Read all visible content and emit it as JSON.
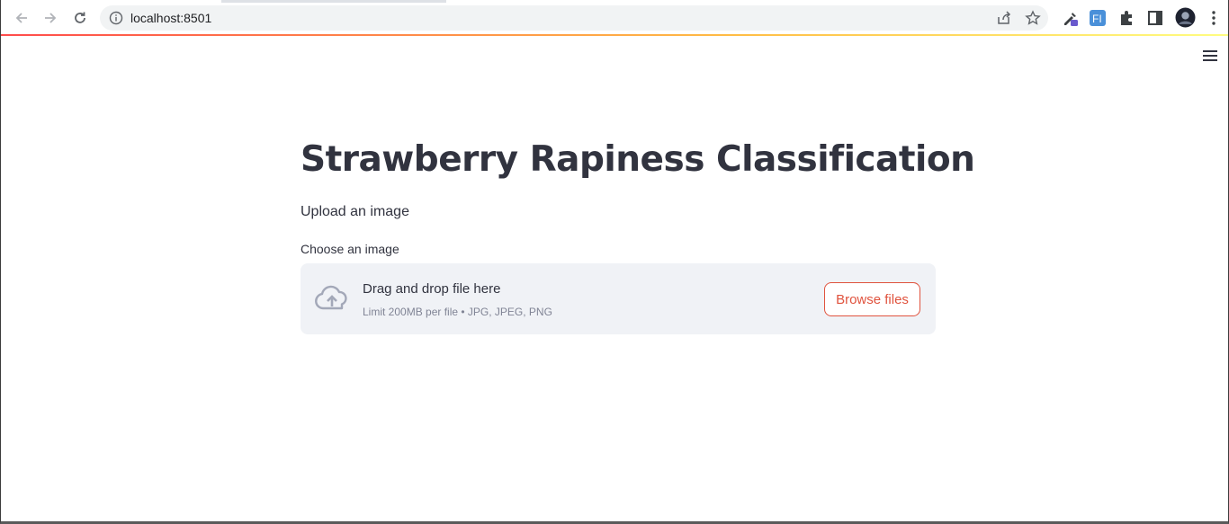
{
  "browser": {
    "url": "localhost:8501",
    "icons": [
      "back-arrow-icon",
      "forward-arrow-icon",
      "reload-icon",
      "info-icon",
      "share-icon",
      "star-icon",
      "eyedropper-extension-icon",
      "translate-extension-icon",
      "puzzle-icon",
      "side-panel-icon",
      "profile-avatar",
      "kebab-menu-icon"
    ]
  },
  "app": {
    "title": "Strawberry Rapiness Classification",
    "subtitle": "Upload an image",
    "uploader": {
      "label": "Choose an image",
      "main_text": "Drag and drop file here",
      "sub_text": "Limit 200MB per file • JPG, JPEG, PNG",
      "button_label": "Browse files"
    }
  },
  "colors": {
    "accent": "#e0533e",
    "text": "#31333f",
    "dropzone_bg": "#f0f2f6",
    "muted": "#808495"
  }
}
